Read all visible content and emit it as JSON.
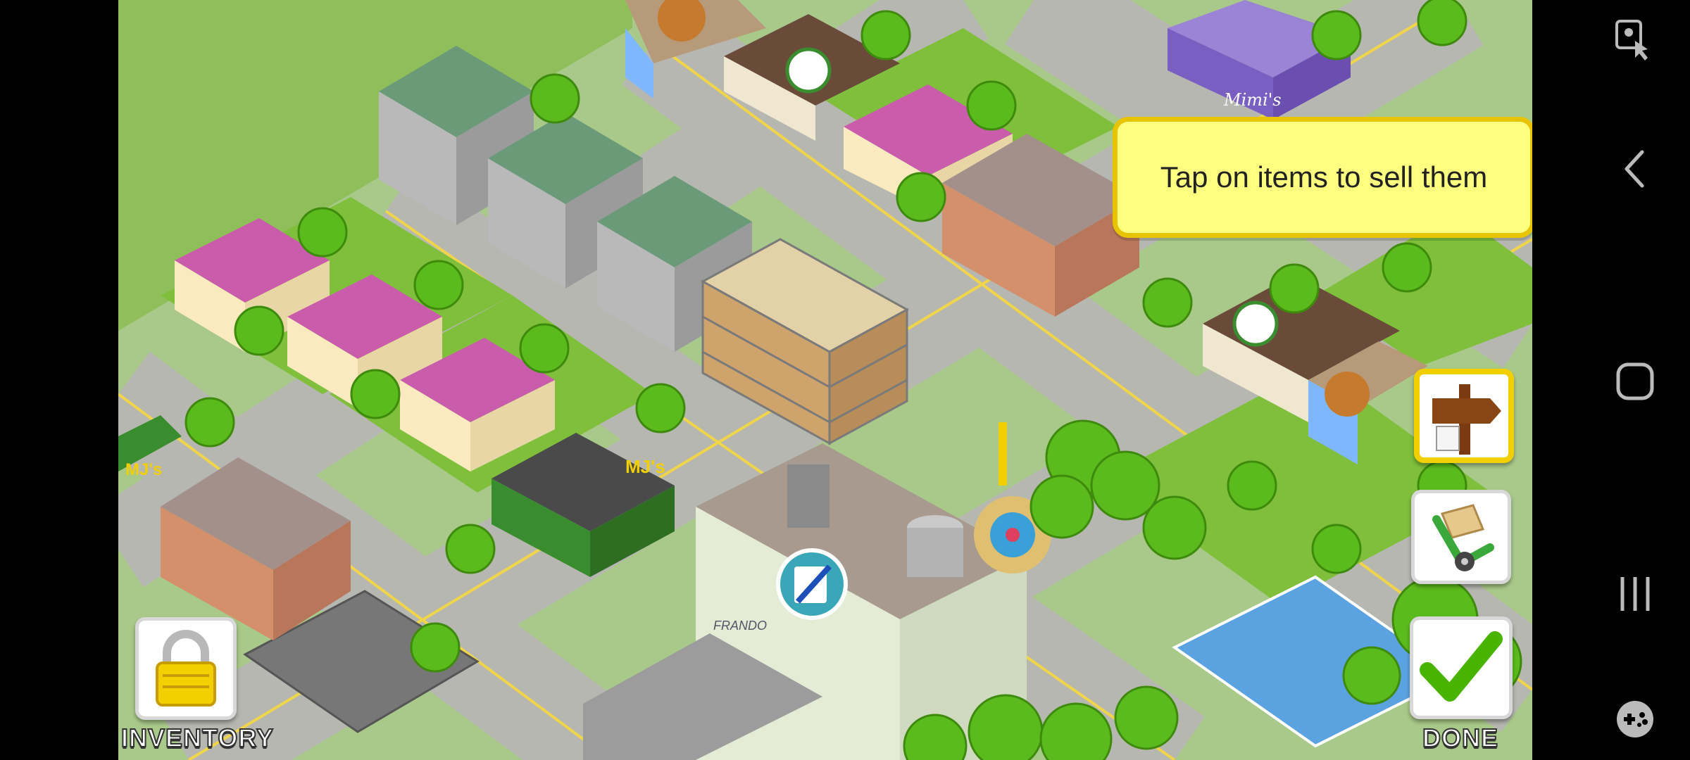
{
  "tooltip": {
    "text": "Tap on items to sell them"
  },
  "buttons": {
    "inventory_label": "INVENTORY",
    "done_label": "DONE"
  },
  "signs": {
    "mimis": "Mimi's",
    "mjs": "MJ's",
    "school": "FRANDO"
  },
  "colors": {
    "grass": "#8fbe5a",
    "road": "#b7b7b1",
    "tooltip_bg": "#ffff80",
    "tooltip_border": "#e8c400",
    "done_check": "#49b400",
    "lock": "#f2d000"
  },
  "icons": {
    "inventory": "padlock-icon",
    "signpost": "signpost-icon",
    "move": "hand-truck-icon",
    "done": "checkmark-icon",
    "nav": [
      "screenshot-touch-icon",
      "back-icon",
      "home-icon",
      "recents-icon",
      "game-tools-icon"
    ]
  }
}
